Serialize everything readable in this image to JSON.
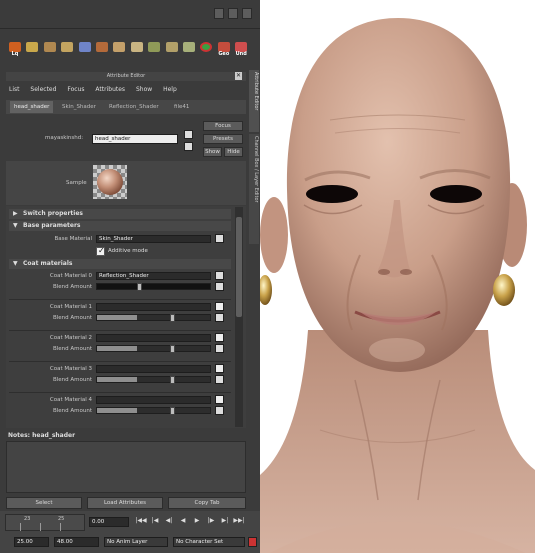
{
  "shelf": {
    "items": [
      {
        "icon": "lq-icon",
        "label": "Lq",
        "color": "#d06020"
      },
      {
        "icon": "uv-grid-icon",
        "label": "",
        "color": "#c9a84b"
      },
      {
        "icon": "checker-icon",
        "label": "",
        "color": "#b08850"
      },
      {
        "icon": "paint-icon",
        "label": "",
        "color": "#c3a460"
      },
      {
        "icon": "cone-icon",
        "label": "",
        "color": "#6f84c8"
      },
      {
        "icon": "capsule-icon",
        "label": "",
        "color": "#b46a3a"
      },
      {
        "icon": "brush-icon",
        "label": "",
        "color": "#c4a06a"
      },
      {
        "icon": "wrench-icon",
        "label": "",
        "color": "#c9b482"
      },
      {
        "icon": "pencil-icon",
        "label": "",
        "color": "#8f9a58"
      },
      {
        "icon": "layer-icon",
        "label": "",
        "color": "#b2a069"
      },
      {
        "icon": "leaf-icon",
        "label": "",
        "color": "#a7b07a"
      },
      {
        "icon": "target-icon",
        "label": "",
        "color": "#3aa040"
      },
      {
        "icon": "geo-icon",
        "label": "Geo",
        "color": "#c54d3d"
      },
      {
        "icon": "und-icon",
        "label": "Und",
        "color": "#cf4e4e"
      }
    ]
  },
  "attribute_editor": {
    "title": "Attribute Editor",
    "menu": [
      "List",
      "Selected",
      "Focus",
      "Attributes",
      "Show",
      "Help"
    ],
    "tabs": [
      "head_shader",
      "Skin_Shader",
      "Reflection_Shader",
      "file41"
    ],
    "node_type_label": "mayaskinshd:",
    "node_name": "head_shader",
    "focus_label": "Focus",
    "presets_label": "Presets",
    "show_label": "Show",
    "hide_label": "Hide",
    "sample_label": "Sample",
    "sections": {
      "switch": "Switch properties",
      "base": "Base parameters",
      "coat": "Coat materials"
    },
    "base_material_label": "Base Material",
    "base_material_value": "Skin_Shader",
    "additive_label": "Additive mode",
    "coats": [
      {
        "label": "Coat Material 0",
        "value": "Reflection_Shader",
        "blend_label": "Blend Amount",
        "blend": 0.0
      },
      {
        "label": "Coat Material 1",
        "value": "",
        "blend_label": "Blend Amount",
        "blend": 0.5
      },
      {
        "label": "Coat Material 2",
        "value": "",
        "blend_label": "Blend Amount",
        "blend": 0.5
      },
      {
        "label": "Coat Material 3",
        "value": "",
        "blend_label": "Blend Amount",
        "blend": 0.5
      },
      {
        "label": "Coat Material 4",
        "value": "",
        "blend_label": "Blend Amount",
        "blend": 0.5
      }
    ],
    "notes_label": "Notes: head_shader",
    "select_label": "Select",
    "load_label": "Load Attributes",
    "copy_label": "Copy Tab"
  },
  "side_tabs": [
    "Attribute Editor",
    "Channel Box / Layer Editor"
  ],
  "timeline": {
    "tick_left": "23",
    "tick_right": "25",
    "current_time": "0.00",
    "range_start": "25.00",
    "range_end": "48.00",
    "anim_layer": "No Anim Layer",
    "character_set": "No Character Set"
  },
  "transport": [
    "first-frame-icon",
    "step-back-icon",
    "prev-key-icon",
    "play-back-icon",
    "play-forward-icon",
    "next-key-icon",
    "step-forward-icon",
    "last-frame-icon"
  ],
  "colors": {
    "panel": "#3b3b3b",
    "skin": "#caa491",
    "background": "#ffffff"
  }
}
